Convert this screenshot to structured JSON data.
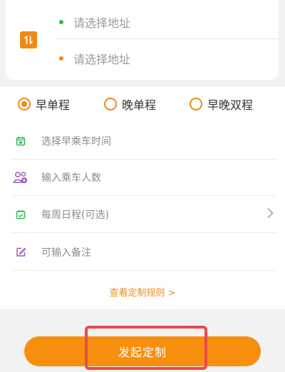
{
  "address": {
    "start_placeholder": "请选择地址",
    "end_placeholder": "请选择地址",
    "start_dot_color": "#2db44b",
    "end_dot_color": "#f08a14",
    "swap_icon": "swap-vertical-icon"
  },
  "trip_types": [
    {
      "label": "早单程",
      "selected": true
    },
    {
      "label": "晚单程",
      "selected": false
    },
    {
      "label": "早晚双程",
      "selected": false
    }
  ],
  "fields": {
    "time": {
      "label": "选择早乘车时间",
      "icon": "calendar-icon",
      "icon_color": "#2db44b"
    },
    "passengers": {
      "label": "输入乘车人数",
      "icon": "people-icon",
      "icon_color": "#9b59b6"
    },
    "schedule": {
      "label": "每周日程(可选)",
      "icon": "calendar-check-icon",
      "icon_color": "#2db44b"
    },
    "note": {
      "label": "可输入备注",
      "icon": "edit-icon",
      "icon_color": "#9b59b6"
    }
  },
  "rules_link": "查看定制规则 >",
  "submit_label": "发起定制",
  "colors": {
    "accent": "#f08a14",
    "highlight": "#e94a4a"
  }
}
